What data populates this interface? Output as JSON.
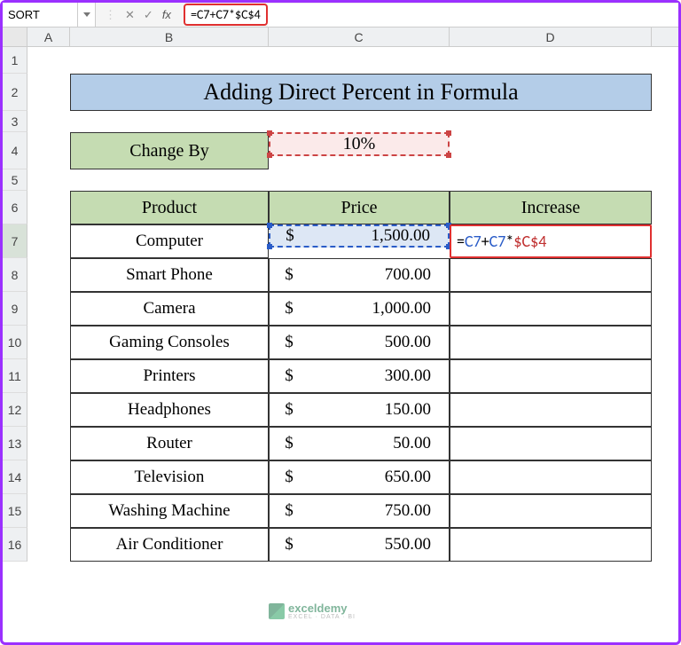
{
  "formula_bar": {
    "name_box": "SORT",
    "formula": "=C7+C7*$C$4"
  },
  "title": "Adding Direct Percent in Formula",
  "change_by": {
    "label": "Change By",
    "value": "10%"
  },
  "headers": {
    "product": "Product",
    "price": "Price",
    "increase": "Increase"
  },
  "rows": [
    {
      "product": "Computer",
      "price": "1,500.00"
    },
    {
      "product": "Smart Phone",
      "price": "700.00"
    },
    {
      "product": "Camera",
      "price": "1,000.00"
    },
    {
      "product": "Gaming Consoles",
      "price": "500.00"
    },
    {
      "product": "Printers",
      "price": "300.00"
    },
    {
      "product": "Headphones",
      "price": "150.00"
    },
    {
      "product": "Router",
      "price": "50.00"
    },
    {
      "product": "Television",
      "price": "650.00"
    },
    {
      "product": "Washing Machine",
      "price": "750.00"
    },
    {
      "product": "Air Conditioner",
      "price": "550.00"
    }
  ],
  "edit_cell": {
    "prefix": "=",
    "c7a": "C7",
    "op1": "+",
    "c7b": "C7",
    "op2": "*",
    "ref2": "$C$4"
  },
  "currency": "$",
  "col_labels": {
    "A": "A",
    "B": "B",
    "C": "C",
    "D": "D"
  },
  "row_labels": [
    "1",
    "2",
    "3",
    "4",
    "5",
    "6",
    "7",
    "8",
    "9",
    "10",
    "11",
    "12",
    "13",
    "14",
    "15",
    "16"
  ],
  "watermark": {
    "name": "exceldemy",
    "sub": "EXCEL · DATA · BI"
  }
}
